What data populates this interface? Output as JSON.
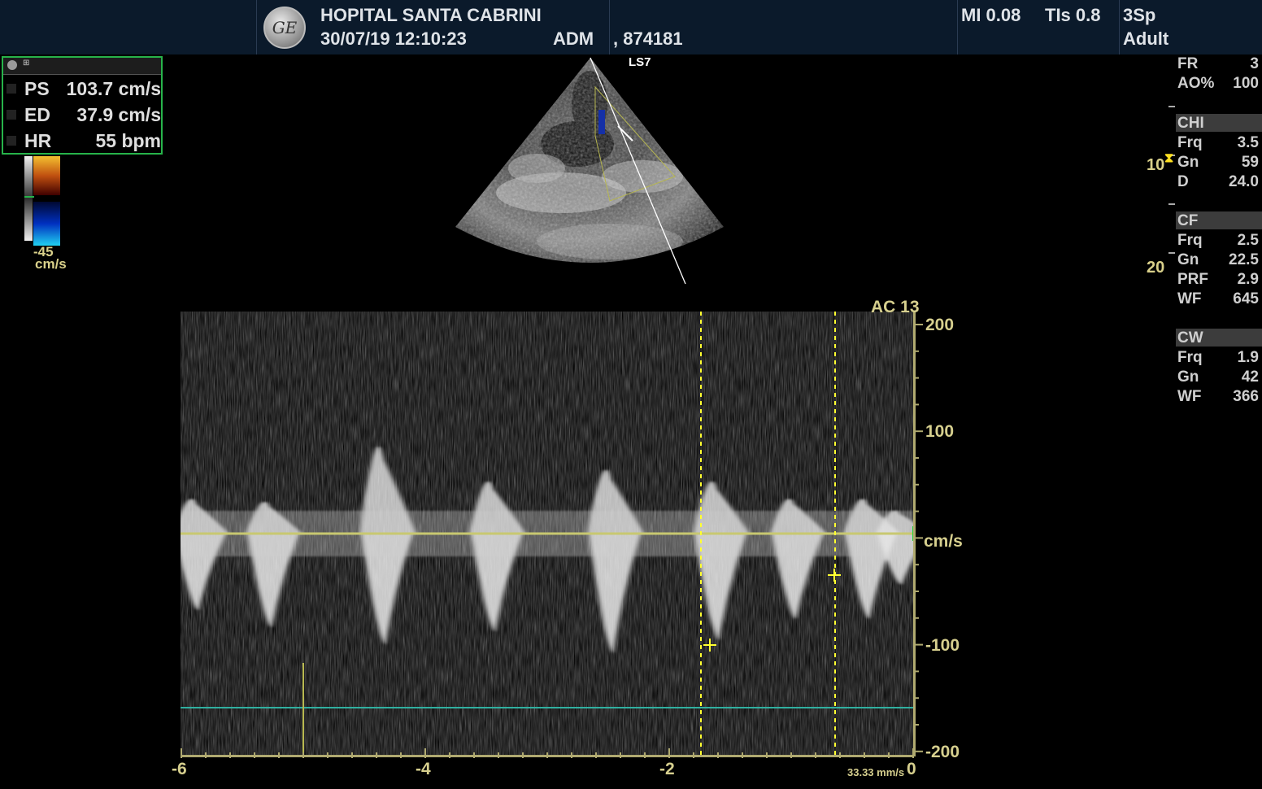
{
  "header": {
    "hospital": "HOPITAL SANTA CABRINI",
    "datetime": "30/07/19 12:10:23",
    "operator": "ADM",
    "patient_id": ", 874181",
    "mi": "MI 0.08",
    "tis": "TIs 0.8",
    "probe": "3Sp",
    "preset": "Adult",
    "logo": "GE"
  },
  "measurements": {
    "rows": [
      {
        "label": "PS",
        "value": "103.7 cm/s"
      },
      {
        "label": "ED",
        "value": "37.9 cm/s"
      },
      {
        "label": "HR",
        "value": "55 bpm"
      }
    ]
  },
  "color_scale": {
    "min_label": "-45",
    "unit": "cm/s"
  },
  "image": {
    "label": "LS7",
    "depth_marks": [
      "10",
      "20"
    ]
  },
  "params": {
    "general": [
      {
        "label": "FR",
        "value": "3"
      },
      {
        "label": "AO%",
        "value": "100"
      }
    ],
    "sections": [
      {
        "title": "CHI",
        "rows": [
          {
            "label": "Frq",
            "value": "3.5"
          },
          {
            "label": "Gn",
            "value": "59"
          },
          {
            "label": "D",
            "value": "24.0"
          }
        ]
      },
      {
        "title": "CF",
        "rows": [
          {
            "label": "Frq",
            "value": "2.5"
          },
          {
            "label": "Gn",
            "value": "22.5"
          },
          {
            "label": "PRF",
            "value": "2.9"
          },
          {
            "label": "WF",
            "value": "645"
          }
        ]
      },
      {
        "title": "CW",
        "rows": [
          {
            "label": "Frq",
            "value": "1.9"
          },
          {
            "label": "Gn",
            "value": "42"
          },
          {
            "label": "WF",
            "value": "366"
          }
        ]
      }
    ]
  },
  "spectrum": {
    "ac_label": "AC 13",
    "y_unit": "cm/s",
    "y_ticks": [
      "200",
      "100",
      "-100",
      "-200"
    ],
    "x_ticks": [
      "-6",
      "-4",
      "-2",
      "0"
    ],
    "sweep_speed": "33.33 mm/s"
  },
  "colors": {
    "header_bg": "#0b1a2b",
    "axis_label": "#d6cf8e",
    "baseline": "#c8c870",
    "cursor": "#ffff30",
    "measure_border": "#27b34a",
    "time_line": "#30b0a0"
  }
}
